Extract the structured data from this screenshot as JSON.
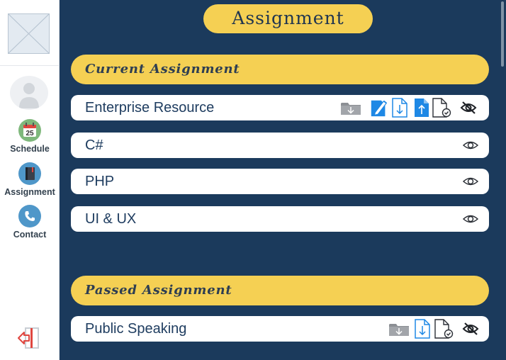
{
  "header": {
    "title": "Assignment"
  },
  "sidebar": {
    "logo": "image-placeholder-icon",
    "avatar": "user-avatar-icon",
    "items": [
      {
        "label": "Schedule",
        "icon": "calendar-icon",
        "badge": "25"
      },
      {
        "label": "Assignment",
        "icon": "notebook-icon"
      },
      {
        "label": "Contact",
        "icon": "phone-icon"
      }
    ],
    "logout": "logout-icon"
  },
  "sections": {
    "current": {
      "title": "Current Assignment",
      "items": [
        {
          "name": "Enterprise Resource",
          "icons": [
            "download-folder-icon",
            "edit-document-icon",
            "download-document-icon",
            "upload-document-icon",
            "submitted-document-icon",
            "hide-icon"
          ]
        },
        {
          "name": "C#",
          "icons": [
            "view-icon"
          ]
        },
        {
          "name": "PHP",
          "icons": [
            "view-icon"
          ]
        },
        {
          "name": "UI & UX",
          "icons": [
            "view-icon"
          ]
        }
      ]
    },
    "passed": {
      "title": "Passed Assignment",
      "items": [
        {
          "name": "Public Speaking",
          "icons": [
            "download-folder-icon",
            "download-document-icon",
            "submitted-document-icon",
            "hide-icon"
          ]
        }
      ]
    }
  },
  "colors": {
    "background": "#1b3a5c",
    "accent": "#f5d053",
    "primary_blue": "#1e88e5",
    "text_dark": "#1f3d60"
  }
}
